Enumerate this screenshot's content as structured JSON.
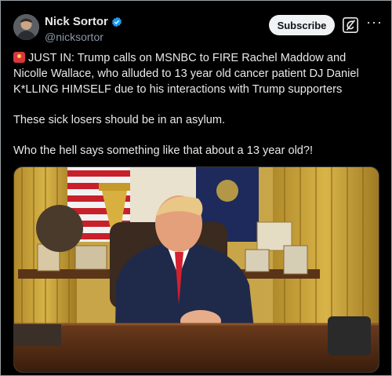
{
  "author": {
    "name": "Nick Sortor",
    "handle": "@nicksortor",
    "verified": true
  },
  "actions": {
    "subscribe_label": "Subscribe",
    "more_label": "···"
  },
  "post": {
    "line1": "JUST IN: Trump calls on MSNBC to FIRE Rachel Maddow and Nicolle Wallace, who alluded to 13 year old cancer patient DJ Daniel K*LLING HIMSELF due to his interactions with Trump supporters",
    "line2": "These sick losers should be in an asylum.",
    "line3": "Who the hell says something like that about a 13 year old?!"
  },
  "colors": {
    "background": "#000000",
    "text": "#e7e9ea",
    "secondary_text": "#8b98a5",
    "verified_badge": "#1d9bf0",
    "subscribe_bg": "#eff3f4"
  },
  "icons": {
    "verified": "verified-badge-icon",
    "grok": "grok-icon",
    "siren": "siren-emoji-icon",
    "more": "more-options-icon"
  }
}
